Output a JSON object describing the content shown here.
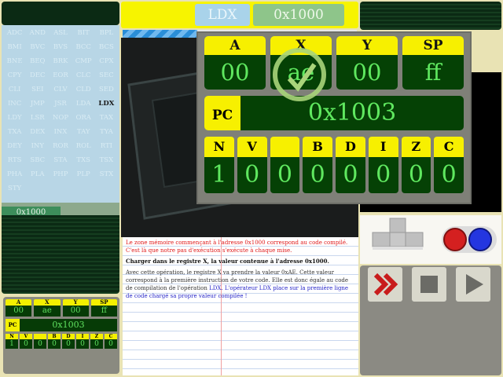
{
  "instruction": {
    "mnemonic": "LDX",
    "address": "0x1000"
  },
  "progress": 0.32,
  "opcodes": [
    "ADC",
    "AND",
    "ASL",
    "BIT",
    "BPL",
    "BMI",
    "BVC",
    "BVS",
    "BCC",
    "BCS",
    "BNE",
    "BEQ",
    "BRK",
    "CMP",
    "CPX",
    "CPY",
    "DEC",
    "EOR",
    "CLC",
    "SEC",
    "CLI",
    "SEI",
    "CLV",
    "CLD",
    "SED",
    "INC",
    "JMP",
    "JSR",
    "LDA",
    "LDX",
    "LDY",
    "LSR",
    "NOP",
    "ORA",
    "TAX",
    "TXA",
    "DEX",
    "INX",
    "TAY",
    "TYA",
    "DEY",
    "INY",
    "ROR",
    "ROL",
    "RTI",
    "RTS",
    "SBC",
    "STA",
    "TXS",
    "TSX",
    "PHA",
    "PLA",
    "PHP",
    "PLP",
    "STX",
    "STY"
  ],
  "active_opcode": "LDX",
  "memory_address": "0x1000",
  "registers": [
    {
      "name": "A",
      "value": "00"
    },
    {
      "name": "X",
      "value": "ae"
    },
    {
      "name": "Y",
      "value": "00"
    },
    {
      "name": "SP",
      "value": "ff"
    }
  ],
  "pc": {
    "name": "PC",
    "value": "0x1003"
  },
  "flags": [
    {
      "name": "N",
      "value": "1"
    },
    {
      "name": "V",
      "value": "0"
    },
    {
      "name": "",
      "value": "0"
    },
    {
      "name": "B",
      "value": "0"
    },
    {
      "name": "D",
      "value": "0"
    },
    {
      "name": "I",
      "value": "0"
    },
    {
      "name": "Z",
      "value": "0"
    },
    {
      "name": "C",
      "value": "0"
    }
  ],
  "notes": {
    "warning": "Le zone mémoire commençant à l'adresse 0x1000 correspond au code compilé. C'est là que notre pas d'exécution s'exécute à chaque mise.",
    "title": "Charger dans le registre X, la valeur contenue à l'adresse 0x1000.",
    "body": "Avec cette opération, le registre X va prendre la valeur 0xAE. Cette valeur correspond à la première instruction de votre code. Elle est donc égale au code de compilation de l'opération",
    "body_hl": "LDX. L'opérateur LDX place sur la première ligne de code chargé sa propre valeur compilée !"
  },
  "colors": {
    "accent_yellow": "#f7f000",
    "reg_green": "#5fe85f",
    "reg_bg": "#054105"
  },
  "icons": {
    "forward": "fast-forward-icon",
    "stop": "stop-icon",
    "play": "play-icon",
    "check": "check-icon"
  }
}
